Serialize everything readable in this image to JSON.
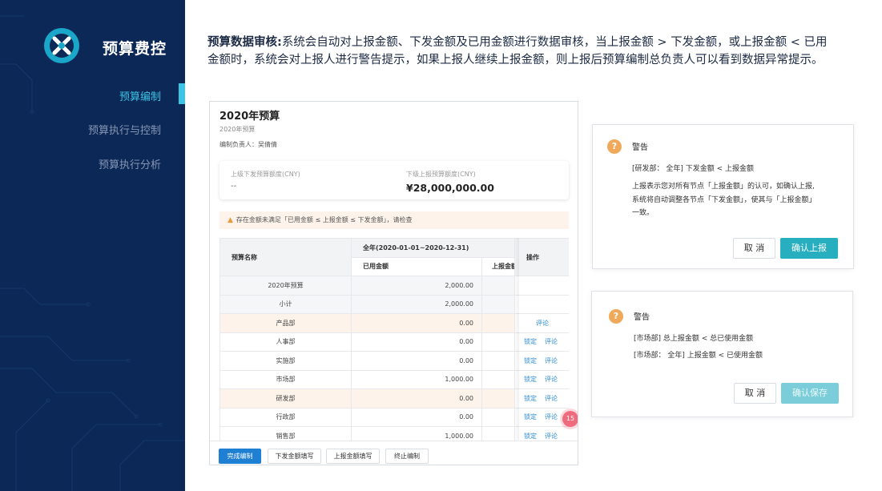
{
  "sidebar": {
    "brand": "预算费控",
    "items": [
      {
        "label": "预算编制",
        "active": true
      },
      {
        "label": "预算执行与控制",
        "active": false
      },
      {
        "label": "预算执行分析",
        "active": false
      }
    ],
    "accent_color": "#3ac4e6",
    "bg_color": "#0c2856"
  },
  "description": {
    "highlight": "预算数据审核:",
    "text": "系统会自动对上报金额、下发金额及已用金额进行数据审核，当上报金额 > 下发金额，或上报金额 < 已用金额时，系统会对上报人进行警告提示，如果上报人继续上报金额，则上报后预算编制总负责人可以看到数据异常提示。"
  },
  "budget": {
    "title": "2020年预算",
    "subtitle": "2020年预算",
    "owner": "编制负责人：吴倩倩",
    "upper_label": "上级下发预算额度(CNY)",
    "upper_value": "--",
    "lower_label": "下级上报预算额度(CNY)",
    "lower_value": "¥28,000,000.00",
    "warning": "存在金额未满足「已用金额 ≤ 上报金额 ≤ 下发金额」，请检查",
    "table": {
      "col_name": "预算名称",
      "col_period": "全年(2020-01-01~2020-12-31)",
      "col_used": "已用金额",
      "col_reported": "上报金额",
      "col_ops": "操作",
      "rows": [
        {
          "name": "2020年预算",
          "used": "2,000.00",
          "style": "gray",
          "ops": []
        },
        {
          "name": "小计",
          "used": "2,000.00",
          "style": "gray",
          "ops": []
        },
        {
          "name": "产品部",
          "used": "0.00",
          "style": "orange",
          "ops": [
            "评论"
          ]
        },
        {
          "name": "人事部",
          "used": "0.00",
          "style": "",
          "ops": [
            "锁定",
            "评论"
          ]
        },
        {
          "name": "实施部",
          "used": "0.00",
          "style": "",
          "ops": [
            "锁定",
            "评论"
          ]
        },
        {
          "name": "市场部",
          "used": "1,000.00",
          "style": "",
          "ops": [
            "锁定",
            "评论"
          ]
        },
        {
          "name": "研发部",
          "used": "0.00",
          "style": "orange",
          "ops": [
            "锁定",
            "评论"
          ]
        },
        {
          "name": "行政部",
          "used": "0.00",
          "style": "",
          "ops": [
            "锁定",
            "评论"
          ]
        },
        {
          "name": "销售部",
          "used": "1,000.00",
          "style": "",
          "ops": [
            "锁定",
            "评论"
          ]
        }
      ]
    },
    "badge": "15",
    "footer": {
      "finish": "完成编制",
      "fill_down": "下发金额填写",
      "fill_up": "上报金额填写",
      "stop": "终止编制"
    }
  },
  "dialog1": {
    "icon": "?",
    "title": "警告",
    "line1": "[研发部： 全年] 下发金额 < 上报金额",
    "line2": "上报表示您对所有节点「上报金额」的认可，如确认上报,",
    "line3": "系统将自动调整各节点「下发金额」，使其与「上报金额」",
    "line4": "一致。",
    "cancel": "取 消",
    "confirm": "确认上报"
  },
  "dialog2": {
    "icon": "?",
    "title": "警告",
    "line1": "[市场部] 总上报金额 < 总已使用金额",
    "line2": "[市场部： 全年] 上报金额 < 已使用金额",
    "cancel": "取 消",
    "confirm": "确认保存"
  }
}
